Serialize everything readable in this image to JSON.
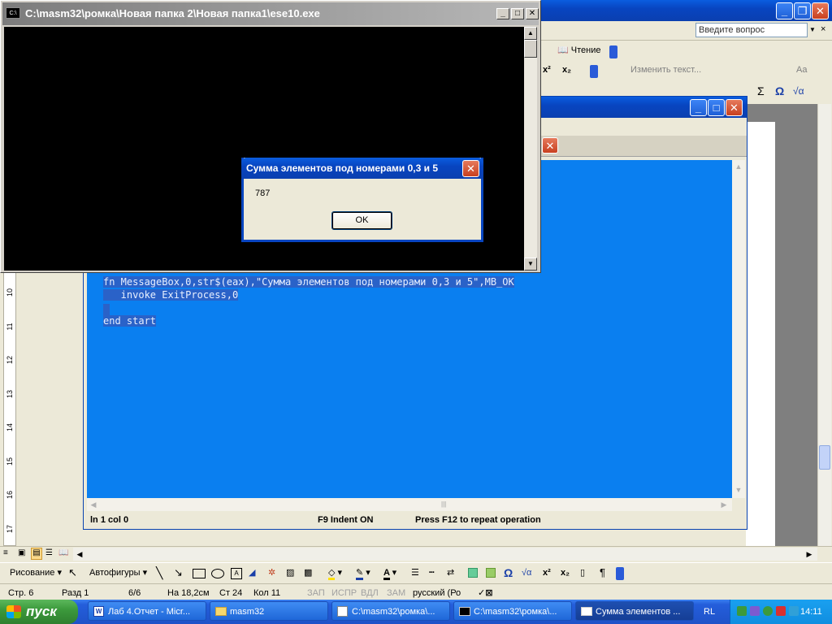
{
  "console": {
    "title": "C:\\masm32\\ромка\\Новая папка 2\\Новая папка1\\ese10.exe",
    "icon": "C:\\"
  },
  "messagebox": {
    "title": "Сумма элементов под номерами 0,3 и 5",
    "text": "787",
    "ok": "OK"
  },
  "word": {
    "help_placeholder": "Введите вопрос",
    "reading_btn": "Чтение",
    "edit_text_btn": "Изменить текст...",
    "draw_menu": "Рисование",
    "autoshapes": "Автофигуры"
  },
  "editor": {
    "lines": [
      "fn MessageBox,0,str$(eax),\"Сумма элементов под номерами 0,3 и 5\",MB_OK",
      "   invoke ExitProcess,0",
      "",
      "end start"
    ],
    "status_pos": "ln 1 col 0",
    "status_indent": "F9 Indent ON",
    "status_repeat": "Press F12 to repeat operation"
  },
  "ruler": {
    "numbers": [
      "10",
      "11",
      "12",
      "13",
      "14",
      "15",
      "16",
      "17"
    ]
  },
  "statusbar": {
    "page": "Стр. 6",
    "section": "Разд 1",
    "pages": "6/6",
    "at": "На 18,2см",
    "line": "Ст 24",
    "col": "Кол 11",
    "rec": "ЗАП",
    "trk": "ИСПР",
    "ext": "ВДЛ",
    "ovr": "ЗАМ",
    "lang": "русский (Ро"
  },
  "taskbar": {
    "start": "пуск",
    "items": [
      "Лаб 4.Отчет - Micr...",
      "masm32",
      "C:\\masm32\\ромка\\...",
      "C:\\masm32\\ромка\\...",
      "Сумма элементов ..."
    ],
    "lang": "RL",
    "clock": "14:11"
  },
  "colors": {
    "editor_bg": "#0a7ff0",
    "xp_blue": "#0a5ddf",
    "taskbar": "#245edb",
    "start_green": "#3c9a3c"
  }
}
